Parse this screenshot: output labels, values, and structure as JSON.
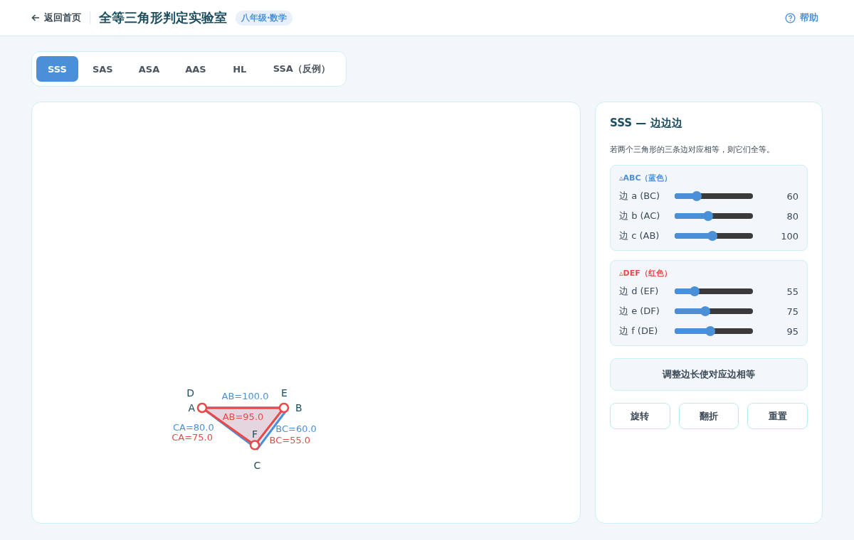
{
  "header": {
    "back": "返回首页",
    "title": "全等三角形判定实验室",
    "badge": "八年级·数学",
    "help": "帮助"
  },
  "tabs": [
    {
      "label": "SSS",
      "selected": true
    },
    {
      "label": "SAS",
      "selected": false
    },
    {
      "label": "ASA",
      "selected": false
    },
    {
      "label": "AAS",
      "selected": false
    },
    {
      "label": "HL",
      "selected": false
    },
    {
      "label": "SSA（反例）",
      "selected": false
    }
  ],
  "canvas": {
    "triangles": [
      {
        "color": "#4a90d9",
        "vertices": [
          "A",
          "B",
          "C"
        ],
        "side_labels": [
          "AB=100.0",
          "BC=60.0",
          "CA=80.0"
        ]
      },
      {
        "color": "#e84a4a",
        "vertices": [
          "D",
          "E",
          "F"
        ],
        "side_labels": [
          "AB=95.0",
          "BC=55.0",
          "CA=75.0"
        ]
      }
    ]
  },
  "panel": {
    "title": "SSS — 边边边",
    "description": "若两个三角形的三条边对应相等，则它们全等。",
    "groups": [
      {
        "label": "▵ABC（蓝色）",
        "color": "#4a90d9",
        "sliders": [
          {
            "label": "边 a (BC)",
            "level": 0.28,
            "reading": "60"
          },
          {
            "label": "边 b (AC)",
            "level": 0.43,
            "reading": "80"
          },
          {
            "label": "边 c (AB)",
            "level": 0.48,
            "reading": "100"
          }
        ]
      },
      {
        "label": "▵DEF（红色）",
        "color": "#e84a4a",
        "sliders": [
          {
            "label": "边 d (EF)",
            "level": 0.25,
            "reading": "55"
          },
          {
            "label": "边 e (DF)",
            "level": 0.39,
            "reading": "75"
          },
          {
            "label": "边 f (DE)",
            "level": 0.45,
            "reading": "95"
          }
        ]
      }
    ],
    "status": "调整边长使对应边相等",
    "actions": [
      "旋转",
      "翻折",
      "重置"
    ]
  }
}
